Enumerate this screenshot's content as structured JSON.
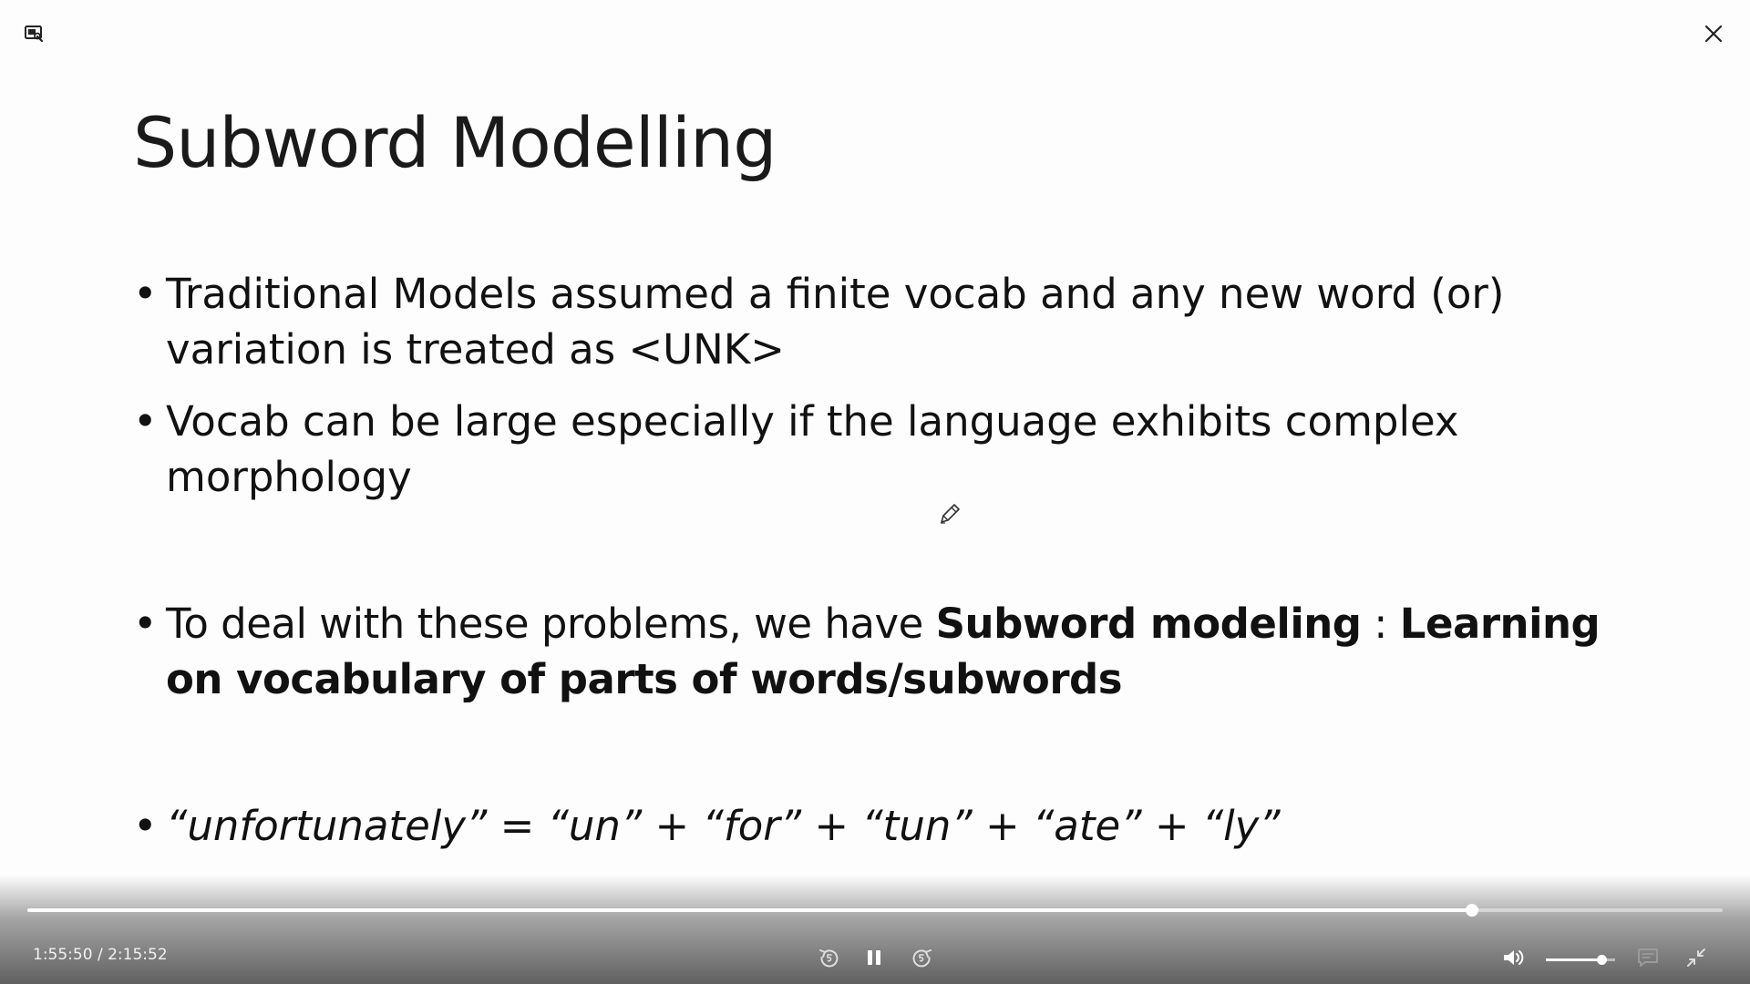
{
  "slide": {
    "title": "Subword Modelling",
    "bullet1": "Traditional Models assumed a finite vocab and any new word (or) variation is treated as <UNK>",
    "bullet2": "Vocab can be large especially if the language exhibits complex morphology",
    "bullet3_prefix": "To deal with these problems, we have ",
    "bullet3_bold1": "Subword modeling",
    "bullet3_sep": " : ",
    "bullet3_bold2": "Learning on vocabulary of parts of words/subwords",
    "bullet4": "“unfortunately” = “un” + “for” + “tun” + “ate” + “ly”"
  },
  "player": {
    "current_time": "1:55:50",
    "separator": " / ",
    "duration": "2:15:52",
    "progress_fraction": 0.852,
    "volume_fraction": 0.8,
    "icons": {
      "info": "screen-info-icon",
      "close": "close-icon",
      "rewind": "rewind-5-icon",
      "pause": "pause-icon",
      "forward": "forward-5-icon",
      "volume": "volume-icon",
      "captions": "captions-icon",
      "exit_fullscreen": "exit-fullscreen-icon",
      "cursor": "pen-cursor-icon"
    },
    "colors": {
      "control_fg": "#ffffff",
      "captions_disabled": "#9a9a9a"
    }
  }
}
